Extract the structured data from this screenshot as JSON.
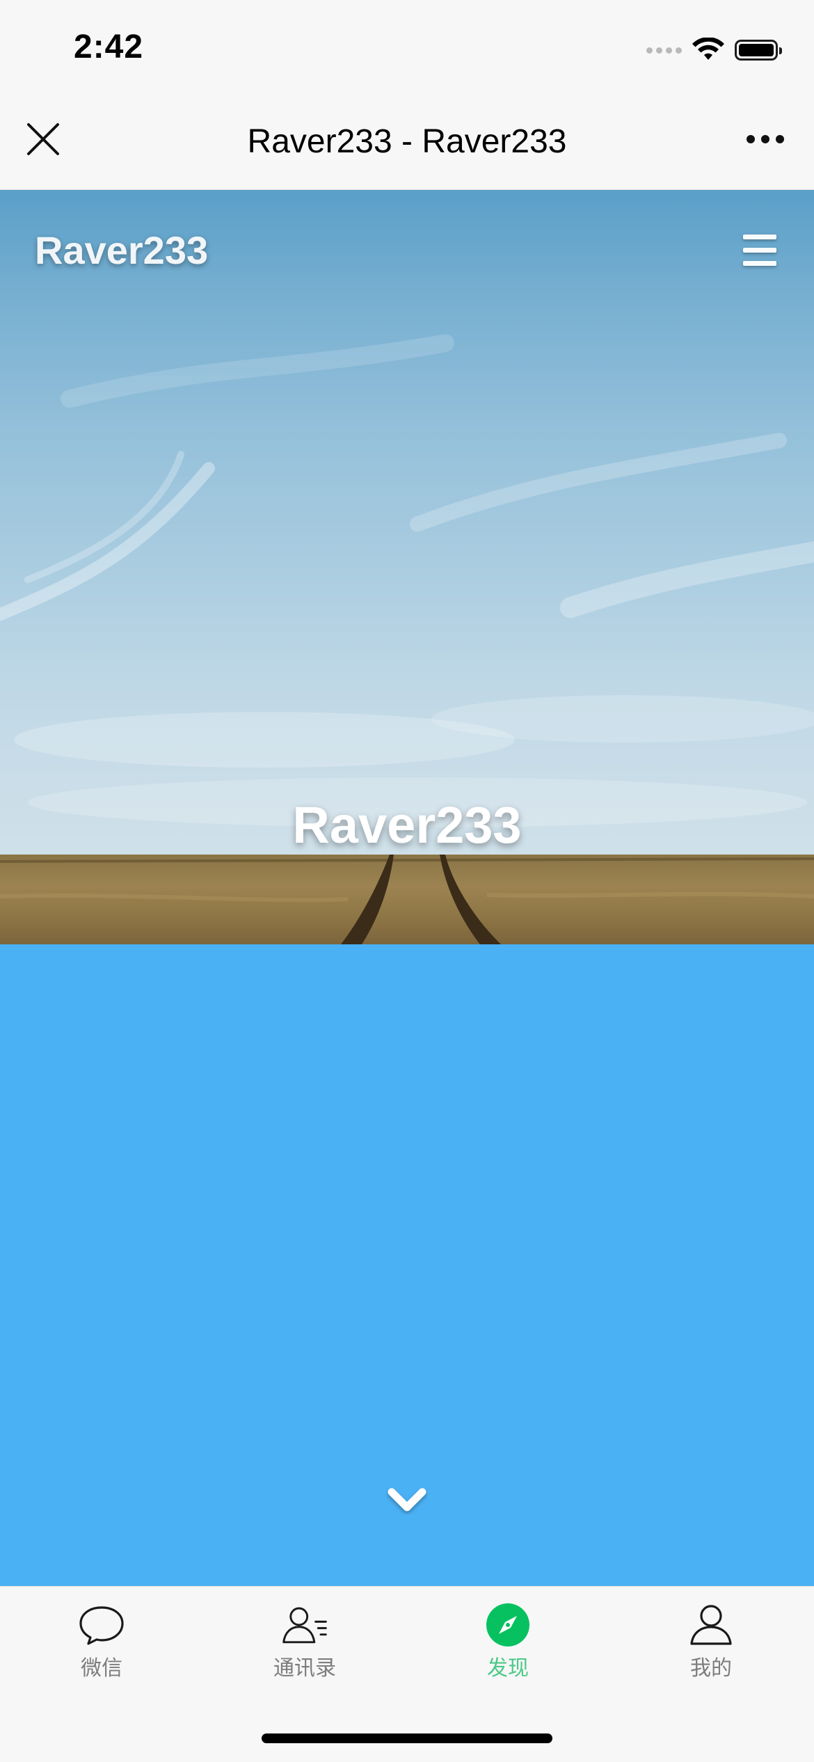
{
  "status_bar": {
    "time": "2:42"
  },
  "nav_bar": {
    "title": "Raver233 - Raver233",
    "close_icon": "close-icon",
    "more_icon": "more-horizontal-icon"
  },
  "site": {
    "brand": "Raver233",
    "menu_icon": "hamburger-menu-icon",
    "hero_title": "Raver233",
    "section_color": "#4bb1f5",
    "scroll_icon": "chevron-down-icon"
  },
  "tab_bar": {
    "active_color": "#4bc986",
    "inactive_color": "#7d7d7d",
    "tabs": [
      {
        "label": "微信",
        "icon": "chat-bubble-icon",
        "active": false
      },
      {
        "label": "通讯录",
        "icon": "contacts-icon",
        "active": false
      },
      {
        "label": "发现",
        "icon": "compass-icon",
        "active": true
      },
      {
        "label": "我的",
        "icon": "person-icon",
        "active": false
      }
    ]
  }
}
